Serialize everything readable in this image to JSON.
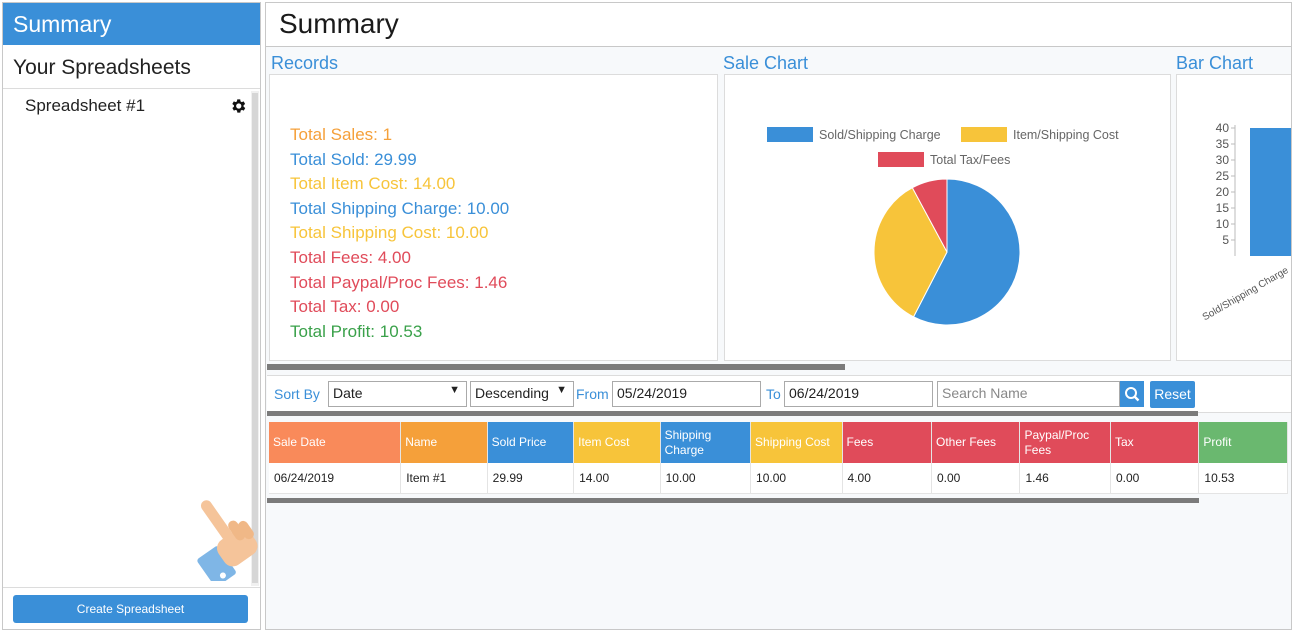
{
  "sidebar": {
    "header": "Summary",
    "subtitle": "Your Spreadsheets",
    "items": [
      {
        "label": "Spreadsheet #1"
      }
    ],
    "create_button": "Create Spreadsheet"
  },
  "page": {
    "title": "Summary"
  },
  "panels": {
    "records_label": "Records",
    "sale_chart_label": "Sale Chart",
    "bar_chart_label": "Bar Chart"
  },
  "records": [
    {
      "text": "Total Sales: 1",
      "color": "#f5a03a"
    },
    {
      "text": "Total Sold: 29.99",
      "color": "#3a8fd8"
    },
    {
      "text": "Total Item Cost: 14.00",
      "color": "#f7c43a"
    },
    {
      "text": "Total Shipping Charge: 10.00",
      "color": "#3a8fd8"
    },
    {
      "text": "Total Shipping Cost: 10.00",
      "color": "#f7c43a"
    },
    {
      "text": "Total Fees: 4.00",
      "color": "#e04b5a"
    },
    {
      "text": "Total Paypal/Proc Fees: 1.46",
      "color": "#e04b5a"
    },
    {
      "text": "Total Tax: 0.00",
      "color": "#e04b5a"
    },
    {
      "text": "Total Profit: 10.53",
      "color": "#3aa14a"
    }
  ],
  "chart_data": [
    {
      "type": "pie",
      "title": "",
      "legend": [
        "Sold/Shipping Charge",
        "Item/Shipping Cost",
        "Total Tax/Fees"
      ],
      "colors": [
        "#3a8fd8",
        "#f7c43a",
        "#e04b5a"
      ],
      "values": [
        39.99,
        24.0,
        5.46
      ]
    },
    {
      "type": "bar",
      "title": "",
      "categories": [
        "Sold/Shipping Charge"
      ],
      "values": [
        40
      ],
      "yticks": [
        "40",
        "35",
        "30",
        "25",
        "20",
        "15",
        "10",
        "5"
      ],
      "ylim": [
        0,
        40
      ],
      "color": "#3a8fd8"
    }
  ],
  "filters": {
    "sort_by_label": "Sort By",
    "sort_field": "Date",
    "sort_order": "Descending",
    "from_label": "From",
    "from_value": "05/24/2019",
    "to_label": "To",
    "to_value": "06/24/2019",
    "search_placeholder": "Search Name",
    "reset_label": "Reset"
  },
  "table": {
    "columns": [
      {
        "label": "Sale Date",
        "color": "#f98a5a"
      },
      {
        "label": "Name",
        "color": "#f5a03a"
      },
      {
        "label": "Sold Price",
        "color": "#3a8fd8"
      },
      {
        "label": "Item Cost",
        "color": "#f7c43a"
      },
      {
        "label": "Shipping Charge",
        "color": "#3a8fd8"
      },
      {
        "label": "Shipping Cost",
        "color": "#f7c43a"
      },
      {
        "label": "Fees",
        "color": "#e04b5a"
      },
      {
        "label": "Other Fees",
        "color": "#e04b5a"
      },
      {
        "label": "Paypal/Proc Fees",
        "color": "#e04b5a"
      },
      {
        "label": "Tax",
        "color": "#e04b5a"
      },
      {
        "label": "Profit",
        "color": "#6ab86f"
      }
    ],
    "rows": [
      [
        "06/24/2019",
        "Item #1",
        "29.99",
        "14.00",
        "10.00",
        "10.00",
        "4.00",
        "0.00",
        "1.46",
        "0.00",
        "10.53"
      ]
    ]
  }
}
